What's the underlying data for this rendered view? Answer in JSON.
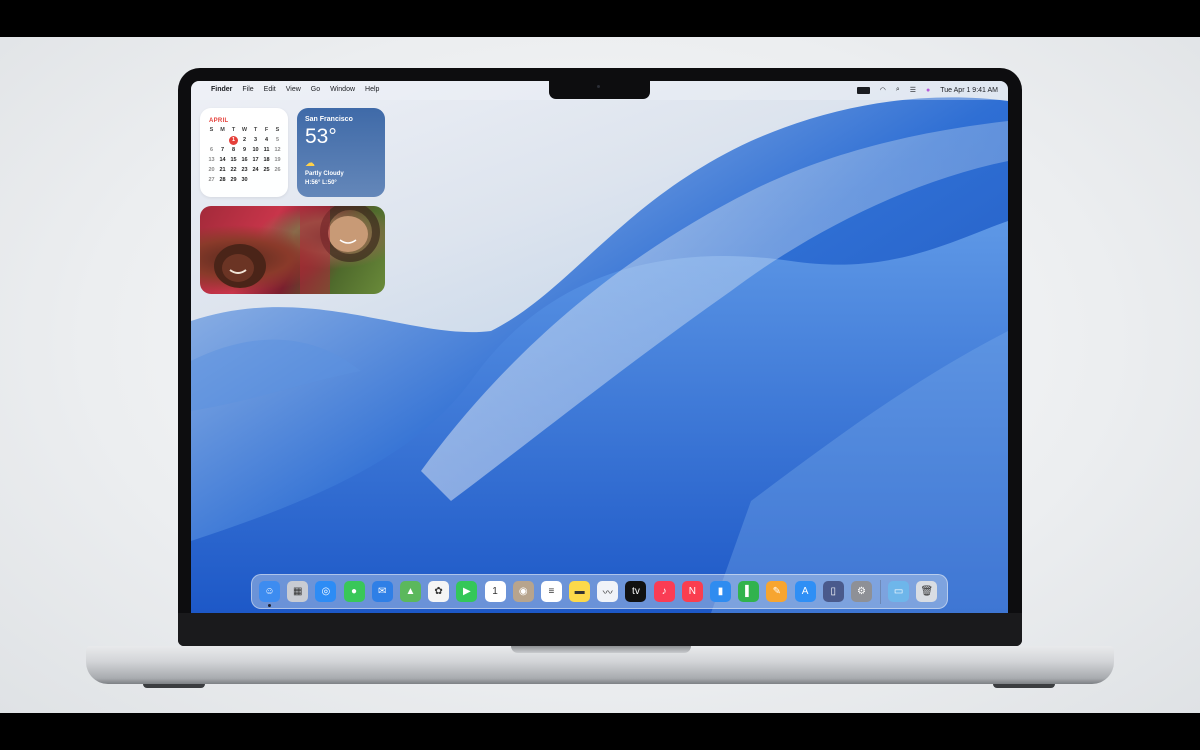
{
  "menubar": {
    "apple": "",
    "app_name": "Finder",
    "menus": [
      "File",
      "Edit",
      "View",
      "Go",
      "Window",
      "Help"
    ],
    "status_icons": [
      "battery-icon",
      "wifi-icon",
      "search-icon",
      "control-center-icon",
      "siri-icon"
    ],
    "clock": "Tue Apr 1  9:41 AM"
  },
  "calendar": {
    "month": "APRIL",
    "weekdays": [
      "S",
      "M",
      "T",
      "W",
      "T",
      "F",
      "S"
    ],
    "weeks": [
      [
        "",
        "",
        "1",
        "2",
        "3",
        "4",
        "5"
      ],
      [
        "6",
        "7",
        "8",
        "9",
        "10",
        "11",
        "12"
      ],
      [
        "13",
        "14",
        "15",
        "16",
        "17",
        "18",
        "19"
      ],
      [
        "20",
        "21",
        "22",
        "23",
        "24",
        "25",
        "26"
      ],
      [
        "27",
        "28",
        "29",
        "30",
        "",
        "",
        ""
      ]
    ],
    "today": "1"
  },
  "weather": {
    "city": "San Francisco",
    "temp": "53°",
    "icon": "partly-cloudy-icon",
    "condition": "Partly Cloudy",
    "high_low": "H:56° L:50°"
  },
  "photo_widget": {
    "icon": "photo-widget"
  },
  "dock": {
    "apps": [
      {
        "name": "finder",
        "color": "#3d8cf0",
        "glyph": "☺",
        "running": true
      },
      {
        "name": "launchpad",
        "color": "#c9ccd3",
        "glyph": "▦"
      },
      {
        "name": "safari",
        "color": "#2d8cf5",
        "glyph": "◎"
      },
      {
        "name": "messages",
        "color": "#39c759",
        "glyph": "●"
      },
      {
        "name": "mail",
        "color": "#2f7fe6",
        "glyph": "✉"
      },
      {
        "name": "maps",
        "color": "#5bb85c",
        "glyph": "▲"
      },
      {
        "name": "photos",
        "color": "#f5f5f5",
        "glyph": "✿"
      },
      {
        "name": "facetime",
        "color": "#34c759",
        "glyph": "▶"
      },
      {
        "name": "calendar",
        "color": "#ffffff",
        "glyph": "1"
      },
      {
        "name": "contacts",
        "color": "#b7a48d",
        "glyph": "◉"
      },
      {
        "name": "reminders",
        "color": "#ffffff",
        "glyph": "≡"
      },
      {
        "name": "notes",
        "color": "#fcd94a",
        "glyph": "▬"
      },
      {
        "name": "freeform",
        "color": "#f0f3f8",
        "glyph": "〰"
      },
      {
        "name": "apple-tv",
        "color": "#111111",
        "glyph": "tv"
      },
      {
        "name": "music",
        "color": "#fa3c54",
        "glyph": "♪"
      },
      {
        "name": "news",
        "color": "#fa3e4f",
        "glyph": "N"
      },
      {
        "name": "keynote",
        "color": "#2f8cf0",
        "glyph": "▮"
      },
      {
        "name": "numbers",
        "color": "#31b34d",
        "glyph": "▌"
      },
      {
        "name": "pages",
        "color": "#f7a530",
        "glyph": "✎"
      },
      {
        "name": "app-store",
        "color": "#2f8ff5",
        "glyph": "A"
      },
      {
        "name": "iphone-mirroring",
        "color": "#4a5a8c",
        "glyph": "▯"
      },
      {
        "name": "system-settings",
        "color": "#8e9096",
        "glyph": "⚙"
      }
    ],
    "trailing": [
      {
        "name": "downloads-folder",
        "color": "#6eb6ea",
        "glyph": "▭"
      },
      {
        "name": "trash",
        "color": "#d9dde3",
        "glyph": "🗑"
      }
    ]
  }
}
